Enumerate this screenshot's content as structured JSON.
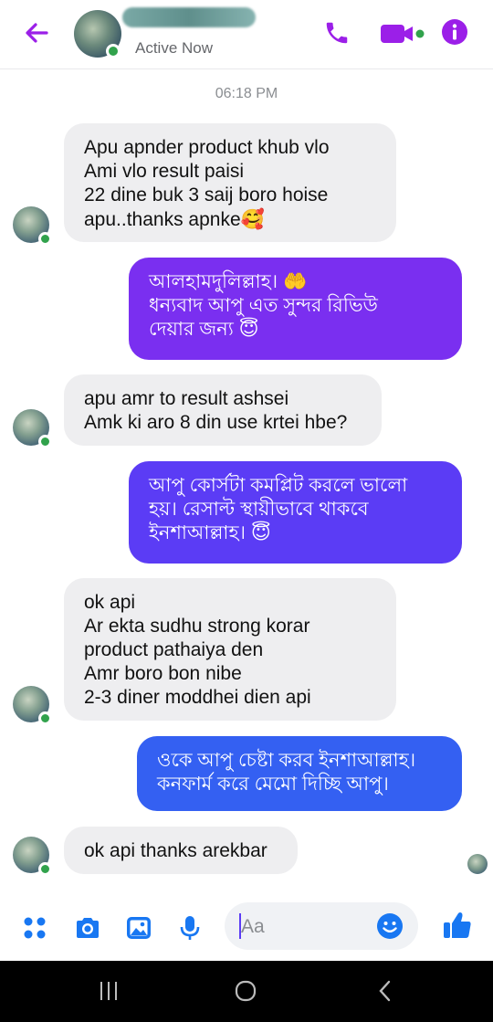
{
  "header": {
    "status": "Active Now",
    "colors": {
      "accent": "#9b1fe8"
    }
  },
  "timestamp": "06:18 PM",
  "messages": [
    {
      "dir": "in",
      "text": "Apu apnder product khub vlo\nAmi vlo result paisi\n22 dine buk 3 saij boro hoise\napu..thanks apnke",
      "emoji": "🥰"
    },
    {
      "dir": "out",
      "text": "আলহামদুলিল্লাহ। 🤲\nধন্যবাদ আপু এত সুন্দর রিভিউ\nদেয়ার জন্য 😇"
    },
    {
      "dir": "in",
      "text": "apu amr to result ashsei\nAmk ki aro 8 din use krtei hbe?"
    },
    {
      "dir": "out",
      "text": "আপু কোর্সটা কমপ্লিট করলে ভালো\nহয়। রেসাল্ট স্থায়ীভাবে থাকবে\nইনশাআল্লাহ। 😇"
    },
    {
      "dir": "in",
      "text": "ok api\nAr ekta sudhu strong korar\nproduct pathaiya den\nAmr boro bon nibe\n2-3 diner moddhei dien api"
    },
    {
      "dir": "out",
      "text": "ওকে আপু চেষ্টা করব ইনশাআল্লাহ।\nকনফার্ম করে মেমো দিচ্ছি আপু।"
    },
    {
      "dir": "in",
      "text": "ok api thanks arekbar"
    }
  ],
  "composer": {
    "placeholder": "Aa",
    "icons": [
      "apps-icon",
      "camera-icon",
      "gallery-icon",
      "microphone-icon",
      "emoji-icon",
      "like-icon"
    ]
  },
  "nav": {
    "recents": "|||",
    "back": "<"
  },
  "colors": {
    "incoming_bg": "#eeeef0",
    "outgoing_1": "#7a2ff0",
    "outgoing_2": "#5b3cf5",
    "outgoing_3": "#3460f2",
    "icon": "#9b1fe8",
    "composer_icon": "#1877f2"
  }
}
